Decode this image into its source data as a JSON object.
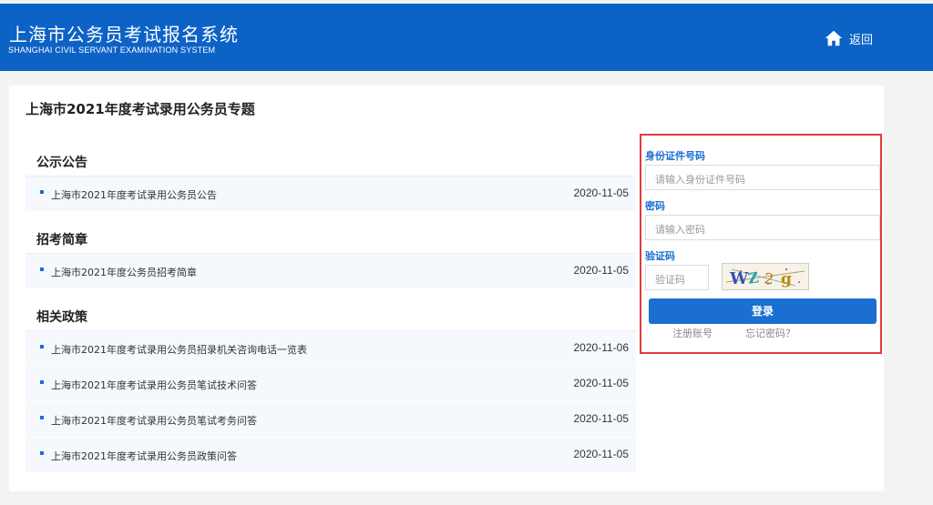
{
  "header": {
    "title": "上海市公务员考试报名系统",
    "subtitle": "SHANGHAI CIVIL SERVANT EXAMINATION SYSTEM",
    "back_label": "返回",
    "color": "#0d62c6"
  },
  "topic": {
    "title": "上海市2021年度考试录用公务员专题"
  },
  "sections": [
    {
      "label": "公示公告",
      "items": [
        {
          "text": "上海市2021年度考试录用公务员公告",
          "date": "2020-11-05"
        }
      ]
    },
    {
      "label": "招考简章",
      "items": [
        {
          "text": "上海市2021年度公务员招考简章",
          "date": "2020-11-05"
        }
      ]
    },
    {
      "label": "相关政策",
      "items": [
        {
          "text": "上海市2021年度考试录用公务员招录机关咨询电话一览表",
          "date": "2020-11-06"
        },
        {
          "text": "上海市2021年度考试录用公务员笔试技术问答",
          "date": "2020-11-05"
        },
        {
          "text": "上海市2021年度考试录用公务员笔试考务问答",
          "date": "2020-11-05"
        },
        {
          "text": "上海市2021年度考试录用公务员政策问答",
          "date": "2020-11-05"
        }
      ]
    }
  ],
  "login": {
    "id_label": "身份证件号码",
    "id_placeholder": "请输入身份证件号码",
    "password_label": "密码",
    "password_placeholder": "请输入密码",
    "captcha_label": "验证码",
    "captcha_placeholder": "验证码",
    "captcha_text": "WZ2g",
    "login_button": "登录",
    "register_link": "注册账号",
    "forgot_link": "忘记密码？",
    "accent": "#1a6fd0",
    "highlight_border": "#e23a3a"
  }
}
